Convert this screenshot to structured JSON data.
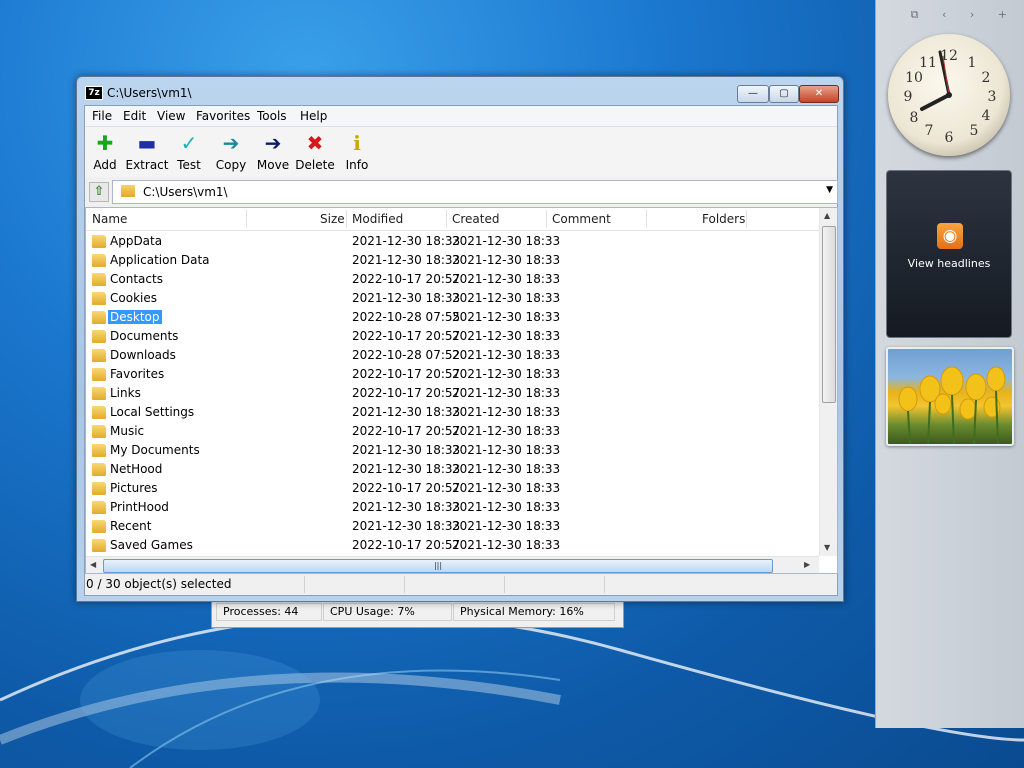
{
  "window": {
    "title": "C:\\Users\\vm1\\",
    "app_icon": "7z",
    "controls": {
      "minimize": "—",
      "maximize": "▢",
      "close": "✕"
    }
  },
  "menu": [
    "File",
    "Edit",
    "View",
    "Favorites",
    "Tools",
    "Help"
  ],
  "toolbar": [
    {
      "label": "Add",
      "icon": "plus-icon",
      "glyph": "✚",
      "color": "#1aa51a"
    },
    {
      "label": "Extract",
      "icon": "minus-icon",
      "glyph": "▬",
      "color": "#1e2fa8"
    },
    {
      "label": "Test",
      "icon": "check-icon",
      "glyph": "✓",
      "color": "#1ab0b8"
    },
    {
      "label": "Copy",
      "icon": "copy-arrow-icon",
      "glyph": "➔",
      "color": "#1a8a9a"
    },
    {
      "label": "Move",
      "icon": "move-arrow-icon",
      "glyph": "➔",
      "color": "#0c1a6a"
    },
    {
      "label": "Delete",
      "icon": "delete-x-icon",
      "glyph": "✖",
      "color": "#d81818"
    },
    {
      "label": "Info",
      "icon": "info-icon",
      "glyph": "i",
      "color": "#c8a800"
    }
  ],
  "address": {
    "path": "C:\\Users\\vm1\\"
  },
  "columns": [
    "Name",
    "Size",
    "Modified",
    "Created",
    "Comment",
    "Folders"
  ],
  "rows": [
    {
      "name": "AppData",
      "modified": "2021-12-30 18:33",
      "created": "2021-12-30 18:33"
    },
    {
      "name": "Application Data",
      "modified": "2021-12-30 18:33",
      "created": "2021-12-30 18:33"
    },
    {
      "name": "Contacts",
      "modified": "2022-10-17 20:57",
      "created": "2021-12-30 18:33"
    },
    {
      "name": "Cookies",
      "modified": "2021-12-30 18:33",
      "created": "2021-12-30 18:33"
    },
    {
      "name": "Desktop",
      "modified": "2022-10-28 07:55",
      "created": "2021-12-30 18:33",
      "selected": true
    },
    {
      "name": "Documents",
      "modified": "2022-10-17 20:57",
      "created": "2021-12-30 18:33"
    },
    {
      "name": "Downloads",
      "modified": "2022-10-28 07:52",
      "created": "2021-12-30 18:33"
    },
    {
      "name": "Favorites",
      "modified": "2022-10-17 20:57",
      "created": "2021-12-30 18:33"
    },
    {
      "name": "Links",
      "modified": "2022-10-17 20:57",
      "created": "2021-12-30 18:33"
    },
    {
      "name": "Local Settings",
      "modified": "2021-12-30 18:33",
      "created": "2021-12-30 18:33"
    },
    {
      "name": "Music",
      "modified": "2022-10-17 20:57",
      "created": "2021-12-30 18:33"
    },
    {
      "name": "My Documents",
      "modified": "2021-12-30 18:33",
      "created": "2021-12-30 18:33"
    },
    {
      "name": "NetHood",
      "modified": "2021-12-30 18:33",
      "created": "2021-12-30 18:33"
    },
    {
      "name": "Pictures",
      "modified": "2022-10-17 20:57",
      "created": "2021-12-30 18:33"
    },
    {
      "name": "PrintHood",
      "modified": "2021-12-30 18:33",
      "created": "2021-12-30 18:33"
    },
    {
      "name": "Recent",
      "modified": "2021-12-30 18:33",
      "created": "2021-12-30 18:33"
    },
    {
      "name": "Saved Games",
      "modified": "2022-10-17 20:57",
      "created": "2021-12-30 18:33"
    }
  ],
  "status": {
    "selection": "0 / 30 object(s) selected"
  },
  "taskmgr": {
    "processes": "Processes: 44",
    "cpu": "CPU Usage: 7%",
    "memory": "Physical Memory: 16%"
  },
  "gadgets": {
    "headlines_label": "View headlines",
    "rss_glyph": "◉",
    "sidebar_controls": "⧉ ‹ › +"
  }
}
